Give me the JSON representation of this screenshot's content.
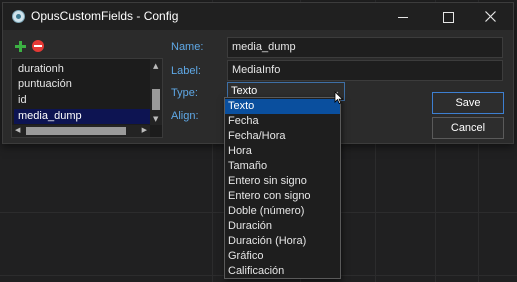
{
  "window": {
    "title": "OpusCustomFields - Config"
  },
  "fields_list": {
    "items": [
      {
        "label": "durationh",
        "selected": false
      },
      {
        "label": "puntuación",
        "selected": false
      },
      {
        "label": "id",
        "selected": false
      },
      {
        "label": "media_dump",
        "selected": true
      }
    ]
  },
  "form": {
    "name_label": "Name:",
    "name_value": "media_dump",
    "label_label": "Label:",
    "label_value": "MediaInfo",
    "type_label": "Type:",
    "type_value": "Texto",
    "align_label": "Align:"
  },
  "buttons": {
    "save": "Save",
    "cancel": "Cancel"
  },
  "type_dropdown": {
    "options": [
      "Texto",
      "Fecha",
      "Fecha/Hora",
      "Hora",
      "Tamaño",
      "Entero sin signo",
      "Entero con signo",
      "Doble (número)",
      "Duración",
      "Duración (Hora)",
      "Gráfico",
      "Calificación"
    ],
    "selected_index": 0
  },
  "colors": {
    "label_blue": "#5fa8e6",
    "selection_dark": "#0d1452",
    "dropdown_selection": "#0a4f9e",
    "add_green": "#3cb043",
    "remove_red": "#e53935"
  },
  "icons": [
    "app-icon",
    "minimize-icon",
    "maximize-icon",
    "close-icon",
    "add-icon",
    "remove-icon",
    "chevron-down-icon",
    "mouse-cursor-icon"
  ]
}
